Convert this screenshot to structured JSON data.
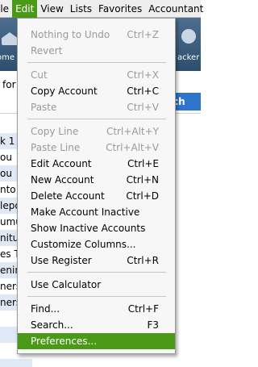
{
  "menubar": {
    "items": [
      {
        "label": "ile"
      },
      {
        "label": "Edit"
      },
      {
        "label": "View"
      },
      {
        "label": "Lists"
      },
      {
        "label": "Favorites"
      },
      {
        "label": "Accountant"
      }
    ]
  },
  "toolbar": {
    "left_label": "ome",
    "right_label": "acker"
  },
  "list": {
    "look_for": "for",
    "search_button": "ch",
    "rows": [
      "k 1",
      "ou",
      "ou",
      "nto",
      "lepo",
      "umu",
      "nitu",
      "es T",
      "enin",
      "ners",
      "ners",
      "",
      "",
      "",
      ""
    ]
  },
  "edit_menu": {
    "groups": [
      [
        {
          "label": "Nothing to Undo",
          "shortcut": "Ctrl+Z",
          "disabled": true
        },
        {
          "label": "Revert",
          "shortcut": "",
          "disabled": true
        }
      ],
      [
        {
          "label": "Cut",
          "shortcut": "Ctrl+X",
          "disabled": true
        },
        {
          "label": "Copy Account",
          "shortcut": "Ctrl+C",
          "disabled": false
        },
        {
          "label": "Paste",
          "shortcut": "Ctrl+V",
          "disabled": true
        }
      ],
      [
        {
          "label": "Copy Line",
          "shortcut": "Ctrl+Alt+Y",
          "disabled": true
        },
        {
          "label": "Paste Line",
          "shortcut": "Ctrl+Alt+V",
          "disabled": true
        },
        {
          "label": "Edit Account",
          "shortcut": "Ctrl+E",
          "disabled": false
        },
        {
          "label": "New Account",
          "shortcut": "Ctrl+N",
          "disabled": false
        },
        {
          "label": "Delete Account",
          "shortcut": "Ctrl+D",
          "disabled": false
        },
        {
          "label": "Make Account Inactive",
          "shortcut": "",
          "disabled": false
        },
        {
          "label": "Show Inactive Accounts",
          "shortcut": "",
          "disabled": false
        },
        {
          "label": "Customize Columns...",
          "shortcut": "",
          "disabled": false
        },
        {
          "label": "Use Register",
          "shortcut": "Ctrl+R",
          "disabled": false
        }
      ],
      [
        {
          "label": "Use Calculator",
          "shortcut": "",
          "disabled": false
        }
      ],
      [
        {
          "label": "Find...",
          "shortcut": "Ctrl+F",
          "disabled": false
        },
        {
          "label": "Search...",
          "shortcut": "F3",
          "disabled": false
        },
        {
          "label": "Preferences...",
          "shortcut": "",
          "disabled": false,
          "selected": true
        }
      ]
    ]
  },
  "colors": {
    "highlight": "#4a9a17",
    "disabled_text": "#9a9a9a",
    "menu_bg": "#f7f7f7",
    "toolbar": "#3d5e80",
    "search_button": "#2e74c8",
    "row_alt": "#dfe9f5"
  },
  "icons": {
    "toolbar_left": "home-icon",
    "toolbar_right": "tracker-icon"
  }
}
